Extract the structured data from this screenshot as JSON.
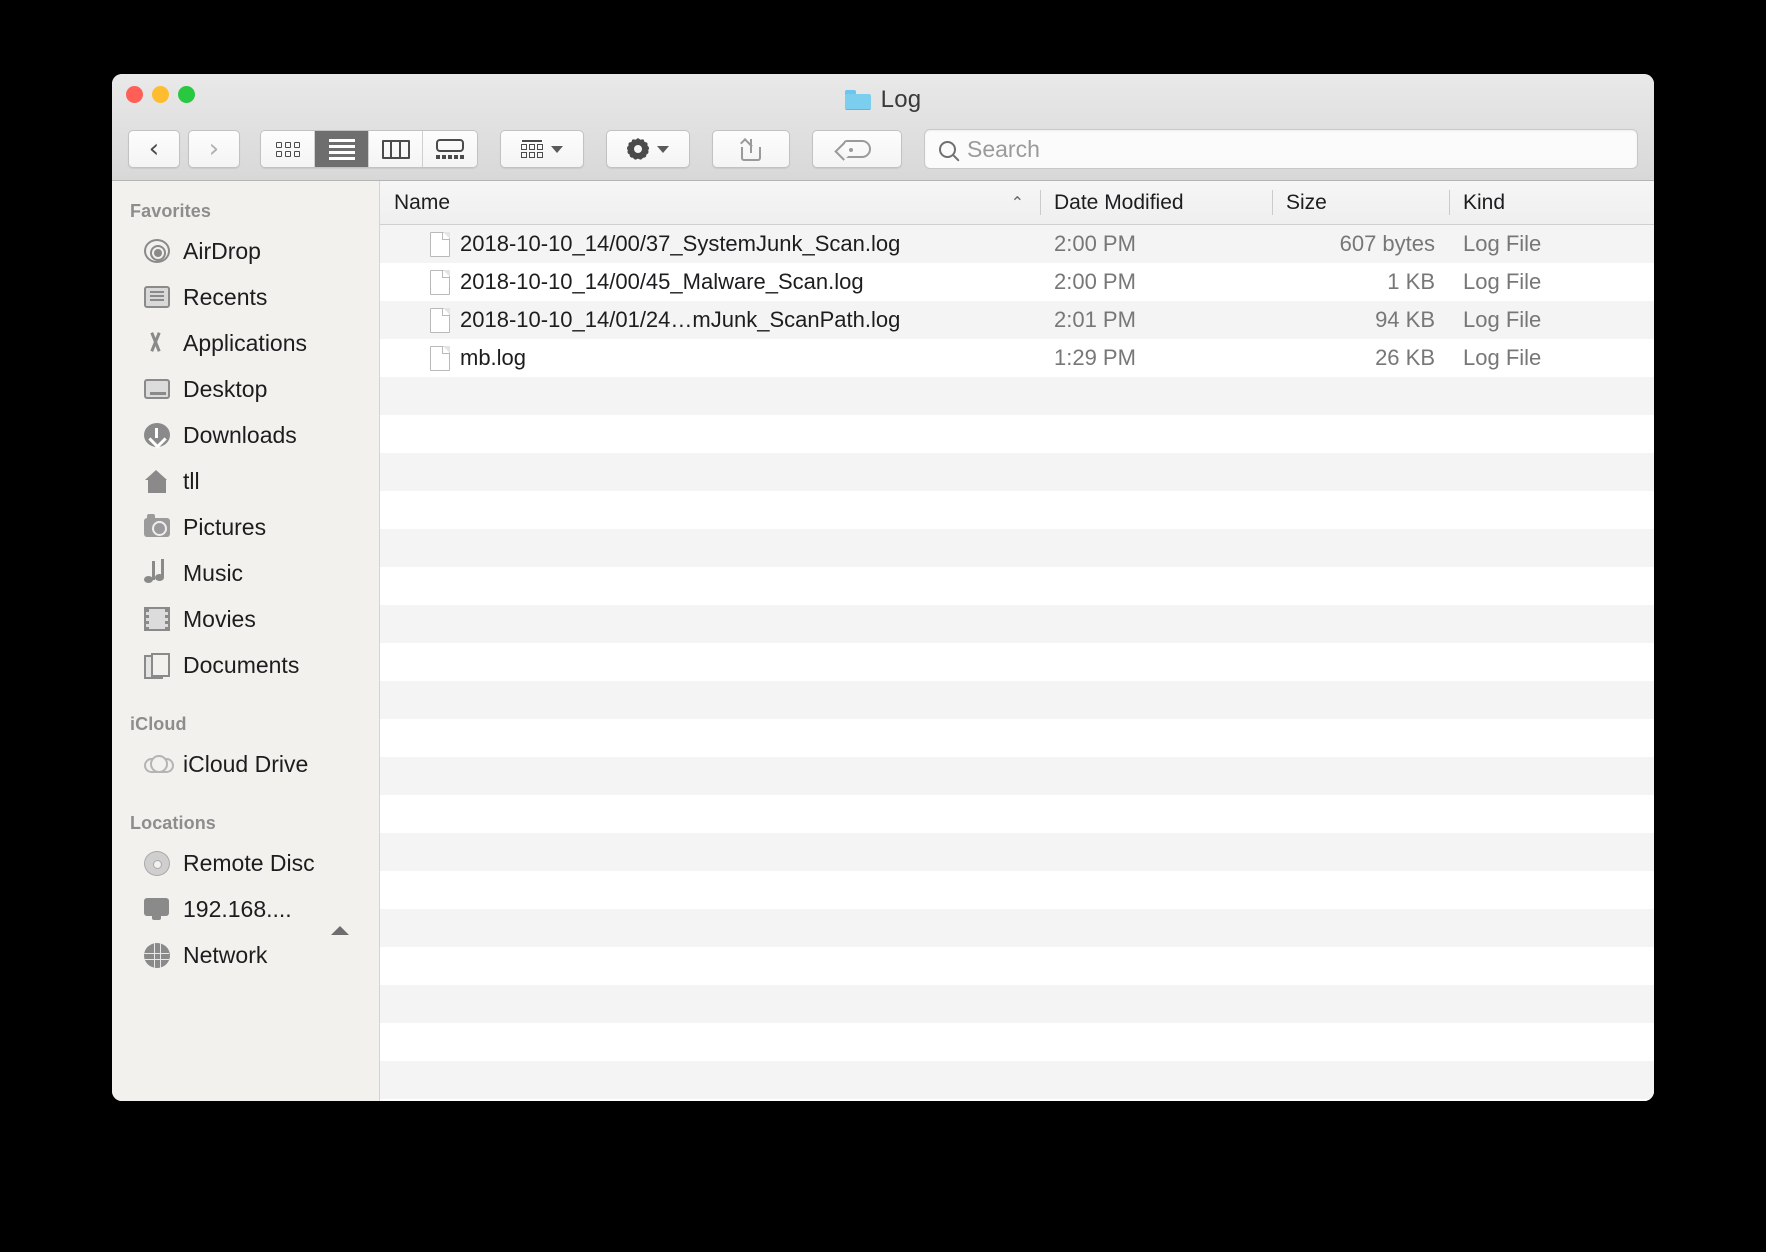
{
  "window": {
    "title": "Log",
    "title_icon": "folder-icon",
    "traffic_lights": [
      {
        "name": "close",
        "color": "#ff5f57"
      },
      {
        "name": "minimize",
        "color": "#febc2e"
      },
      {
        "name": "zoom",
        "color": "#28c840"
      }
    ]
  },
  "toolbar": {
    "back_label": "‹",
    "forward_label": "›",
    "view_modes": [
      {
        "name": "icon-view",
        "active": false
      },
      {
        "name": "list-view",
        "active": true
      },
      {
        "name": "column-view",
        "active": false
      },
      {
        "name": "gallery-view",
        "active": false
      }
    ],
    "arrange_label": "",
    "action_label": "",
    "share_label": "",
    "tags_label": ""
  },
  "search": {
    "placeholder": "Search",
    "value": ""
  },
  "sidebar": {
    "groups": [
      {
        "title": "Favorites",
        "items": [
          {
            "label": "AirDrop",
            "icon": "airdrop-icon"
          },
          {
            "label": "Recents",
            "icon": "recents-icon"
          },
          {
            "label": "Applications",
            "icon": "applications-icon"
          },
          {
            "label": "Desktop",
            "icon": "desktop-icon"
          },
          {
            "label": "Downloads",
            "icon": "downloads-icon"
          },
          {
            "label": "tll",
            "icon": "home-icon"
          },
          {
            "label": "Pictures",
            "icon": "pictures-icon"
          },
          {
            "label": "Music",
            "icon": "music-icon"
          },
          {
            "label": "Movies",
            "icon": "movies-icon"
          },
          {
            "label": "Documents",
            "icon": "documents-icon"
          }
        ]
      },
      {
        "title": "iCloud",
        "items": [
          {
            "label": "iCloud Drive",
            "icon": "cloud-icon"
          }
        ]
      },
      {
        "title": "Locations",
        "items": [
          {
            "label": "Remote Disc",
            "icon": "disc-icon"
          },
          {
            "label": "192.168....",
            "icon": "monitor-icon",
            "eject": true
          },
          {
            "label": "Network",
            "icon": "globe-icon"
          }
        ]
      }
    ]
  },
  "filelist": {
    "columns": [
      {
        "key": "name",
        "label": "Name",
        "sorted": true,
        "sort_indicator": "⌃"
      },
      {
        "key": "date",
        "label": "Date Modified"
      },
      {
        "key": "size",
        "label": "Size"
      },
      {
        "key": "kind",
        "label": "Kind"
      }
    ],
    "rows": [
      {
        "name": "2018-10-10_14/00/37_SystemJunk_Scan.log",
        "date": "2:00 PM",
        "size": "607 bytes",
        "kind": "Log File",
        "icon": "document-icon"
      },
      {
        "name": "2018-10-10_14/00/45_Malware_Scan.log",
        "date": "2:00 PM",
        "size": "1 KB",
        "kind": "Log File",
        "icon": "document-icon"
      },
      {
        "name": "2018-10-10_14/01/24…mJunk_ScanPath.log",
        "date": "2:01 PM",
        "size": "94 KB",
        "kind": "Log File",
        "icon": "document-icon"
      },
      {
        "name": "mb.log",
        "date": "1:29 PM",
        "size": "26 KB",
        "kind": "Log File",
        "icon": "document-icon"
      }
    ],
    "empty_row_count": 20
  },
  "colors": {
    "sidebar_bg": "#f2f1ee",
    "stripe": "#f4f4f4",
    "titlebar": "#e3e3e3",
    "folder_blue": "#7cceef"
  }
}
